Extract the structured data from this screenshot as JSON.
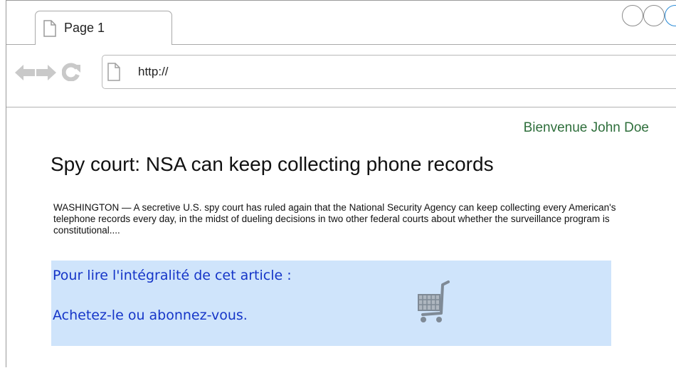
{
  "browser": {
    "tab_title": "Page 1",
    "address_value": "http://",
    "icons": {
      "tab": "page-icon",
      "back": "back-arrow-icon",
      "forward": "forward-arrow-icon",
      "reload": "reload-icon",
      "address": "page-icon"
    },
    "window_controls": [
      "circle-button",
      "circle-button",
      "circle-button"
    ]
  },
  "page": {
    "welcome": "Bienvenue John Doe",
    "headline": "Spy court: NSA can keep collecting phone records",
    "summary": "WASHINGTON — A secretive U.S. spy court has ruled again that the National Security Agency can keep collecting every American's telephone records every day, in the midst of dueling decisions in two other federal courts about whether the surveillance program is constitutional....",
    "paywall": {
      "line1": "Pour lire l'intégralité de cet article :",
      "line2": "Achetez-le ou abonnez-vous.",
      "icon": "shopping-cart-icon"
    }
  },
  "colors": {
    "welcome": "#2f6f3c",
    "paywall_background": "#cfe4fb",
    "paywall_text": "#1535c8",
    "active_window_control": "#2a8bd6"
  }
}
